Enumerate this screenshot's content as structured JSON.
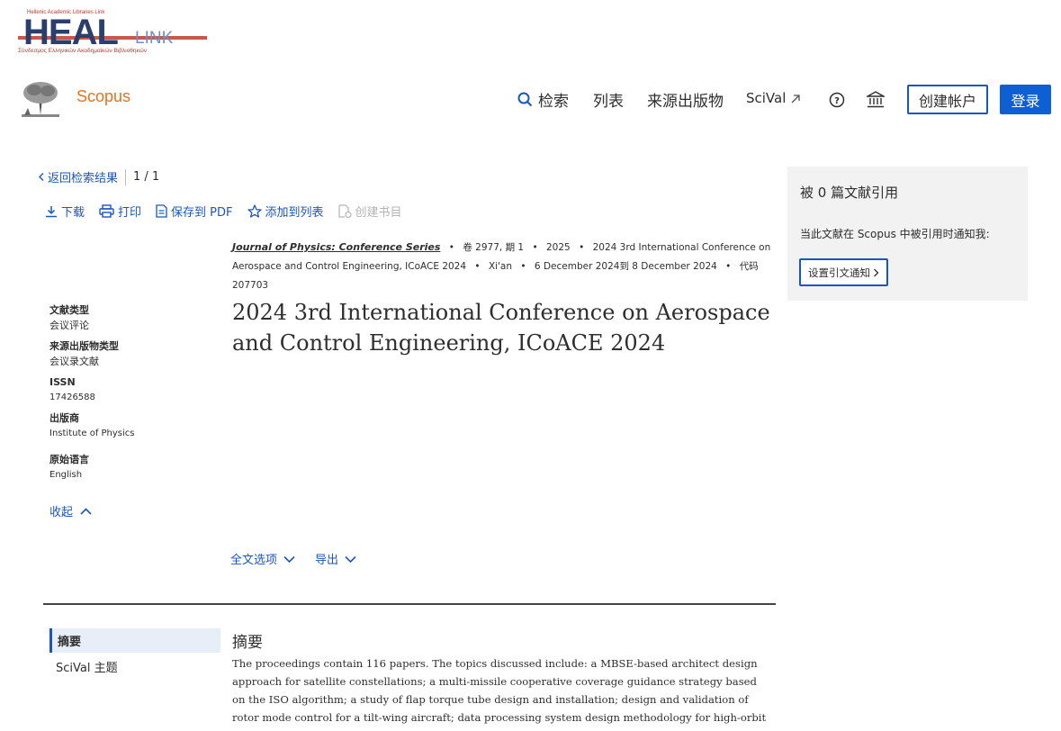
{
  "banner": {
    "top_text": "Hellenic Academic Libraries Link",
    "big": "HEAL",
    "link": "LINK",
    "subtitle": "Σύνδεσμος Ελληνικών Ακαδημαϊκών Βιβλιοθηκών"
  },
  "header": {
    "brand": "Scopus",
    "nav": {
      "search": "检索",
      "lists": "列表",
      "sources": "来源出版物",
      "scival": "SciVal"
    },
    "create_account": "创建帐户",
    "login": "登录"
  },
  "back": {
    "label": "返回检索结果",
    "pager": "1 / 1"
  },
  "actions": {
    "download": "下载",
    "print": "打印",
    "save_pdf": "保存到 PDF",
    "add_list": "添加到列表",
    "create_bib": "创建书目"
  },
  "meta": {
    "journal": "Journal of Physics: Conference Series",
    "volume": "卷 2977, 期 1",
    "year": "2025",
    "conference": "2024 3rd International Conference on Aerospace and Control Engineering, ICoACE 2024",
    "location": "Xi'an",
    "dates": "6 December 2024到 8 December 2024",
    "code": "代码 207703"
  },
  "title": "2024 3rd International Conference on Aerospace and Control Engineering, ICoACE 2024",
  "info": {
    "doc_type_label": "文献类型",
    "doc_type": "会议评论",
    "source_type_label": "来源出版物类型",
    "source_type": "会议录文献",
    "issn_label": "ISSN",
    "issn": "17426588",
    "publisher_label": "出版商",
    "publisher": "Institute of Physics",
    "language_label": "原始语言",
    "language": "English"
  },
  "collapse": "收起",
  "fulltext": {
    "options": "全文选项",
    "export": "导出"
  },
  "tabs": {
    "abstract": "摘要",
    "scival": "SciVal 主题"
  },
  "abstract": {
    "heading": "摘要",
    "text": "The proceedings contain 116 papers. The topics discussed include: a MBSE-based architect design approach for satellite constellations; a multi-missile cooperative coverage guidance strategy based on the ISO algorithm; a study of flap torque tube design and installation; design and validation of rotor mode control for a tilt-wing aircraft; data processing system design methodology for high-orbit remote sensing satellites; trajectory planning and guidance design for the powered-descent phase of a reusable launch vehicle; and adaptive control."
  },
  "cited": {
    "title": "被 0 篇文献引用",
    "notice": "当此文献在 Scopus 中被引用时通知我:",
    "button": "设置引文通知"
  },
  "colors": {
    "accent": "#1a56c2",
    "brand_orange": "#e9711c",
    "panel_bg": "#f2f2f2"
  }
}
